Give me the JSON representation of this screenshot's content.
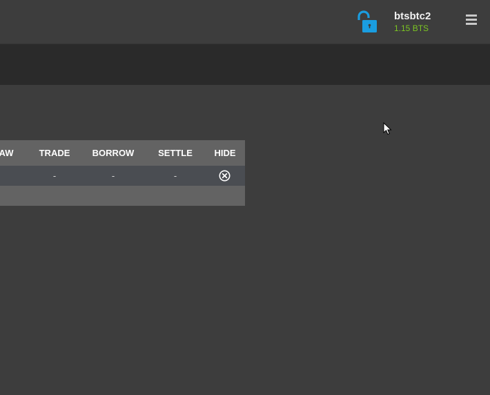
{
  "header": {
    "account_name": "btsbtc2",
    "account_balance": "1.15 BTS",
    "lock_icon": "unlocked-padlock-icon",
    "menu_icon": "hamburger-menu-icon"
  },
  "table": {
    "columns": [
      "AW",
      "TRADE",
      "BORROW",
      "SETTLE",
      "HIDE"
    ],
    "rows": [
      {
        "trade": "-",
        "borrow": "-",
        "settle": "-",
        "hide_icon": "circle-x-icon"
      }
    ]
  },
  "colors": {
    "accent_blue": "#1a9de0",
    "balance_green": "#7cc622",
    "background": "#3d3d3d",
    "subbar": "#2a2a2a"
  }
}
